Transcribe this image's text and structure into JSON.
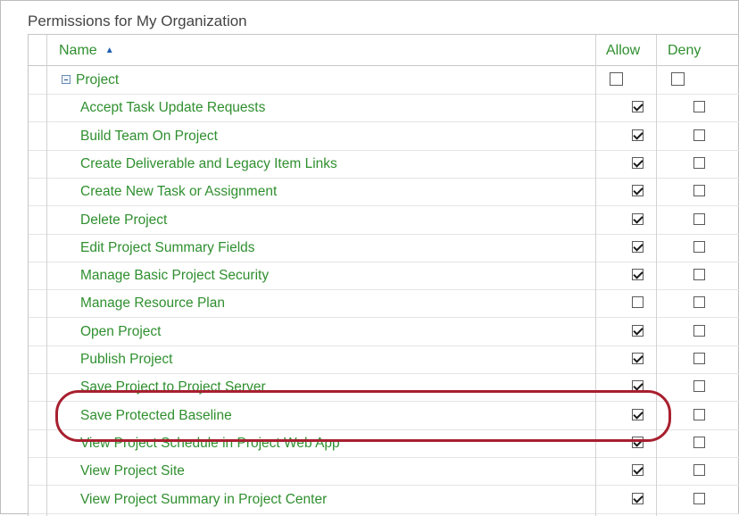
{
  "section_title": "Permissions for My Organization",
  "columns": {
    "name": "Name",
    "allow": "Allow",
    "deny": "Deny"
  },
  "group": {
    "label": "Project",
    "allow": false,
    "deny": false
  },
  "rows": [
    {
      "label": "Accept Task Update Requests",
      "allow": true,
      "deny": false
    },
    {
      "label": "Build Team On Project",
      "allow": true,
      "deny": false
    },
    {
      "label": "Create Deliverable and Legacy Item Links",
      "allow": true,
      "deny": false
    },
    {
      "label": "Create New Task or Assignment",
      "allow": true,
      "deny": false
    },
    {
      "label": "Delete Project",
      "allow": true,
      "deny": false
    },
    {
      "label": "Edit Project Summary Fields",
      "allow": true,
      "deny": false
    },
    {
      "label": "Manage Basic Project Security",
      "allow": true,
      "deny": false
    },
    {
      "label": "Manage Resource Plan",
      "allow": false,
      "deny": false
    },
    {
      "label": "Open Project",
      "allow": true,
      "deny": false
    },
    {
      "label": "Publish Project",
      "allow": true,
      "deny": false
    },
    {
      "label": "Save Project to Project Server",
      "allow": true,
      "deny": false
    },
    {
      "label": "Save Protected Baseline",
      "allow": true,
      "deny": false
    },
    {
      "label": "View Project Schedule in Project Web App",
      "allow": true,
      "deny": false
    },
    {
      "label": "View Project Site",
      "allow": true,
      "deny": false
    },
    {
      "label": "View Project Summary in Project Center",
      "allow": true,
      "deny": false
    }
  ],
  "colors": {
    "link_green": "#2f8f2f",
    "highlight_red": "#a8202f",
    "sort_arrow": "#1e5fb0"
  }
}
